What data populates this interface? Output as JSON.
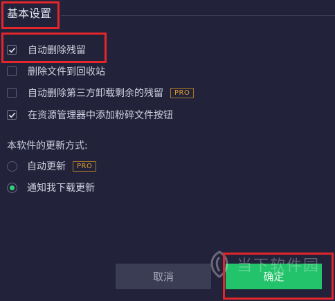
{
  "section": {
    "title": "基本设置"
  },
  "options": [
    {
      "label": "自动删除残留",
      "checked": true,
      "pro": ""
    },
    {
      "label": "删除文件到回收站",
      "checked": false,
      "pro": ""
    },
    {
      "label": "自动删除第三方卸载剩余的残留",
      "checked": false,
      "pro": "PRO"
    },
    {
      "label": "在资源管理器中添加粉碎文件按钮",
      "checked": true,
      "pro": ""
    }
  ],
  "update": {
    "heading": "本软件的更新方式:",
    "choices": [
      {
        "label": "自动更新",
        "selected": false,
        "pro": "PRO"
      },
      {
        "label": "通知我下载更新",
        "selected": true,
        "pro": ""
      }
    ]
  },
  "buttons": {
    "cancel": "取消",
    "ok": "确定"
  },
  "watermark": {
    "text": "当下软件园"
  },
  "colors": {
    "background": "#22233a",
    "accent": "#22c36a",
    "pro": "#e1a02a",
    "highlight": "#e3262a"
  },
  "icons": {
    "check": "check-icon",
    "radio_dot": "radio-dot-icon",
    "logo": "watermark-logo-icon"
  }
}
